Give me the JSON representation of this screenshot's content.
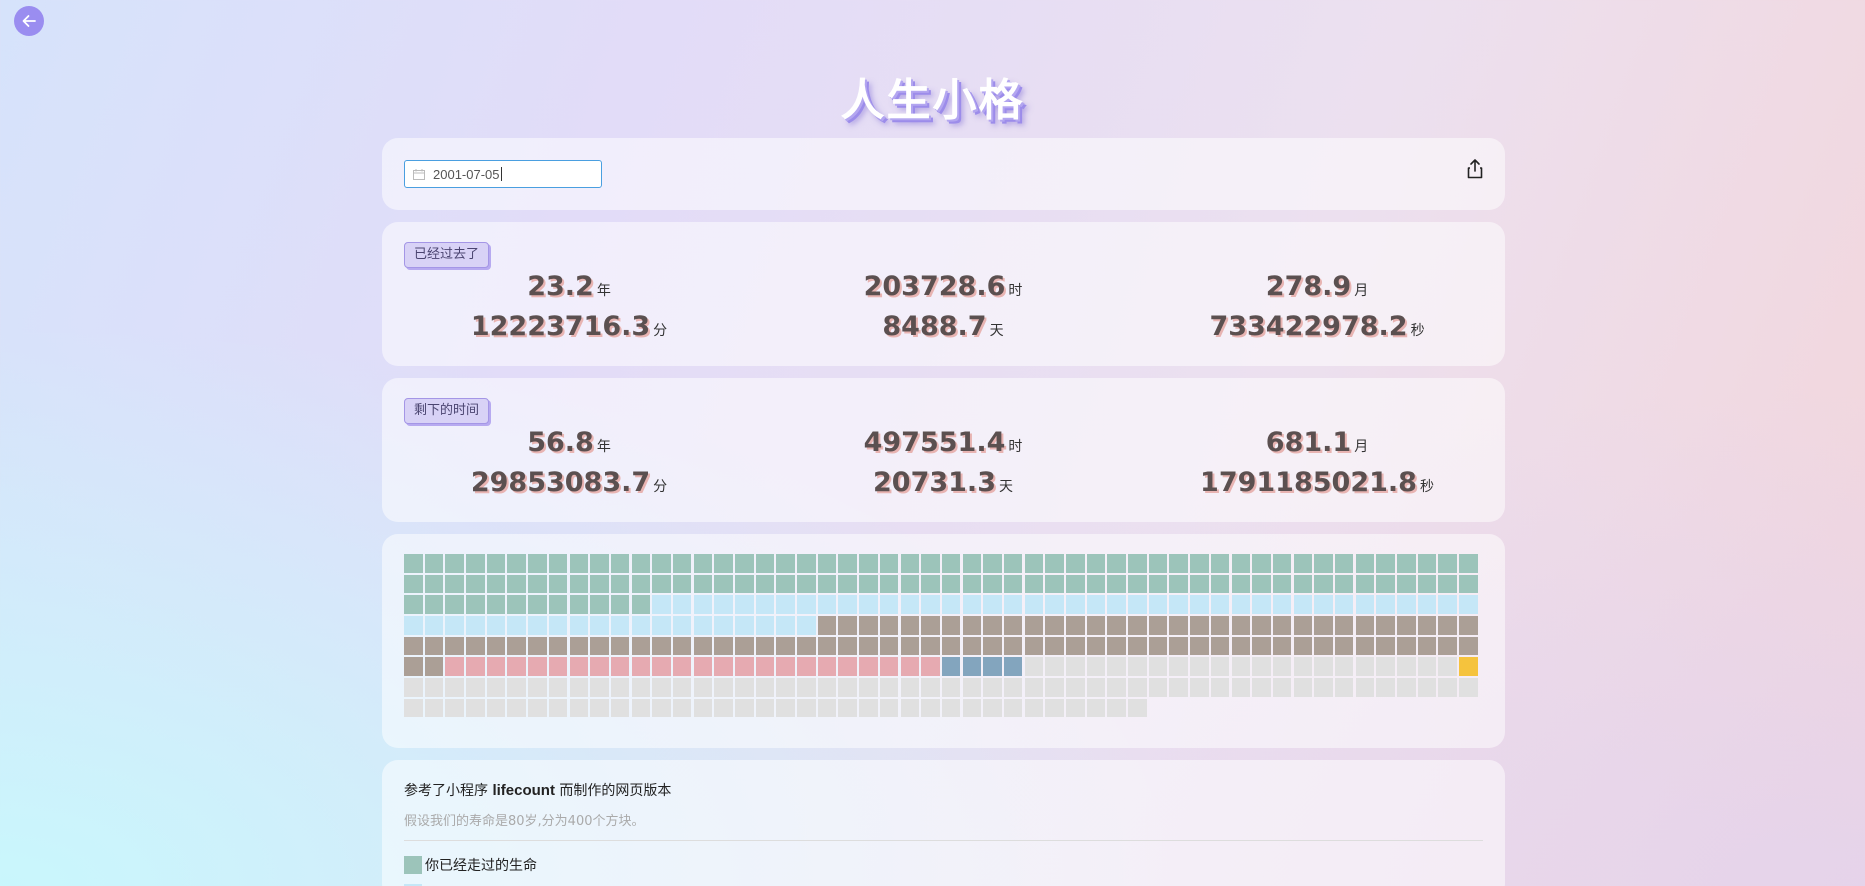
{
  "header": {
    "title": "人生小格"
  },
  "date_picker": {
    "value": "2001-07-05"
  },
  "passed": {
    "label": "已经过去了",
    "stats": [
      {
        "value": "23.2",
        "unit": "年"
      },
      {
        "value": "203728.6",
        "unit": "时"
      },
      {
        "value": "278.9",
        "unit": "月"
      },
      {
        "value": "12223716.3",
        "unit": "分"
      },
      {
        "value": "8488.7",
        "unit": "天"
      },
      {
        "value": "733422978.2",
        "unit": "秒"
      }
    ]
  },
  "remaining": {
    "label": "剩下的时间",
    "stats": [
      {
        "value": "56.8",
        "unit": "年"
      },
      {
        "value": "497551.4",
        "unit": "时"
      },
      {
        "value": "681.1",
        "unit": "月"
      },
      {
        "value": "29853083.7",
        "unit": "分"
      },
      {
        "value": "20731.3",
        "unit": "天"
      },
      {
        "value": "1791185021.8",
        "unit": "秒"
      }
    ]
  },
  "grid": {
    "total": 400,
    "segments": [
      {
        "type": "passed",
        "count": 116,
        "color": "#9cc4ba"
      },
      {
        "type": "sleep",
        "count": 60,
        "color": "#c5e7f7"
      },
      {
        "type": "work",
        "count": 86,
        "color": "#ab9f96"
      },
      {
        "type": "family",
        "count": 24,
        "color": "#e6aab1"
      },
      {
        "type": "retire",
        "count": 4,
        "color": "#83a5be"
      },
      {
        "type": "empty",
        "count": 21,
        "color": "#e0e0e0"
      },
      {
        "type": "now",
        "count": 1,
        "color": "#f5c33d"
      },
      {
        "type": "empty",
        "count": 88,
        "color": "#e0e0e0"
      }
    ]
  },
  "info": {
    "line1_prefix": "参考了小程序",
    "line1_bold": "lifecount",
    "line1_suffix": "而制作的网页版本",
    "line2": "假设我们的寿命是80岁,分为400个方块。",
    "legend": [
      {
        "label": "你已经走过的生命",
        "color": "#9cc4ba"
      },
      {
        "label": "",
        "color": "#c5e7f7"
      }
    ]
  },
  "icons": {
    "back": "arrow-left-icon",
    "calendar": "calendar-icon",
    "share": "share-icon"
  }
}
